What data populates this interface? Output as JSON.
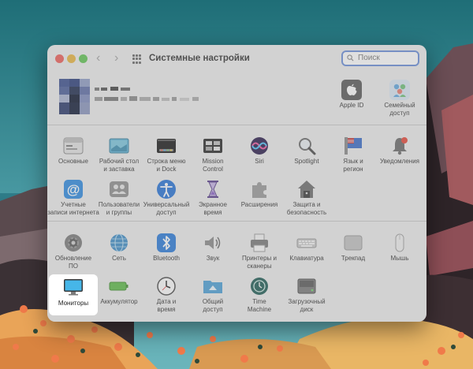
{
  "window": {
    "title": "Системные настройки",
    "search_placeholder": "Поиск"
  },
  "account": {
    "items": [
      {
        "label": "Apple ID",
        "icon": "apple-logo-icon"
      },
      {
        "label": "Семейный\nдоступ",
        "icon": "family-sharing-icon"
      }
    ]
  },
  "sections": [
    {
      "items": [
        {
          "label": "Основные",
          "icon": "general-icon"
        },
        {
          "label": "Рабочий стол\nи заставка",
          "icon": "desktop-screensaver-icon"
        },
        {
          "label": "Строка меню\nи Dock",
          "icon": "menubar-dock-icon"
        },
        {
          "label": "Mission\nControl",
          "icon": "mission-control-icon"
        },
        {
          "label": "Siri",
          "icon": "siri-icon"
        },
        {
          "label": "Spotlight",
          "icon": "spotlight-icon"
        },
        {
          "label": "Язык и\nрегион",
          "icon": "language-region-icon"
        },
        {
          "label": "Уведомления",
          "icon": "notifications-icon"
        },
        {
          "label": "Учетные\nзаписи интернета",
          "icon": "internet-accounts-icon"
        },
        {
          "label": "Пользователи\nи группы",
          "icon": "users-groups-icon"
        },
        {
          "label": "Универсальный\nдоступ",
          "icon": "accessibility-icon"
        },
        {
          "label": "Экранное\nвремя",
          "icon": "screen-time-icon"
        },
        {
          "label": "Расширения",
          "icon": "extensions-icon"
        },
        {
          "label": "Защита и\nбезопасность",
          "icon": "security-privacy-icon"
        }
      ]
    },
    {
      "items": [
        {
          "label": "Обновление\nПО",
          "icon": "software-update-icon"
        },
        {
          "label": "Сеть",
          "icon": "network-icon"
        },
        {
          "label": "Bluetooth",
          "icon": "bluetooth-icon"
        },
        {
          "label": "Звук",
          "icon": "sound-icon"
        },
        {
          "label": "Принтеры и\nсканеры",
          "icon": "printers-scanners-icon"
        },
        {
          "label": "Клавиатура",
          "icon": "keyboard-icon"
        },
        {
          "label": "Трекпад",
          "icon": "trackpad-icon"
        },
        {
          "label": "Мышь",
          "icon": "mouse-icon"
        },
        {
          "label": "Мониторы",
          "icon": "displays-icon",
          "highlighted": true
        },
        {
          "label": "Аккумулятор",
          "icon": "battery-icon"
        },
        {
          "label": "Дата и\nвремя",
          "icon": "date-time-icon"
        },
        {
          "label": "Общий\nдоступ",
          "icon": "sharing-icon"
        },
        {
          "label": "Time\nMachine",
          "icon": "time-machine-icon"
        },
        {
          "label": "Загрузочный\nдиск",
          "icon": "startup-disk-icon"
        }
      ]
    }
  ]
}
